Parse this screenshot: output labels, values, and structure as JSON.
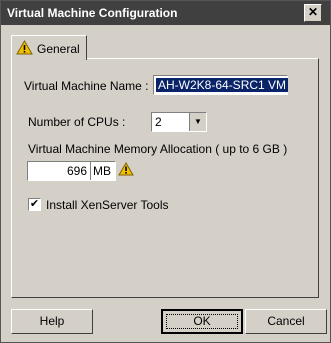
{
  "window": {
    "title": "Virtual Machine Configuration",
    "close_glyph": "✕"
  },
  "tabs": [
    {
      "label": "General",
      "icon": "warning-icon"
    }
  ],
  "form": {
    "vm_name_label": "Virtual Machine Name :",
    "vm_name_value": "AH-W2K8-64-SRC1 VM",
    "cpus_label": "Number of CPUs :",
    "cpus_value": "2",
    "memory_label": "Virtual Machine Memory Allocation ( up to 6 GB )",
    "memory_value": "696",
    "memory_unit": "MB",
    "xen_tools_label": "Install XenServer Tools",
    "xen_tools_checked": true,
    "check_glyph": "✔"
  },
  "buttons": {
    "help": "Help",
    "ok": "OK",
    "cancel": "Cancel"
  },
  "colors": {
    "titlebar": "#404040",
    "dialog": "#d4d0c8",
    "selection": "#0a246a",
    "warning": "#f0c000"
  }
}
